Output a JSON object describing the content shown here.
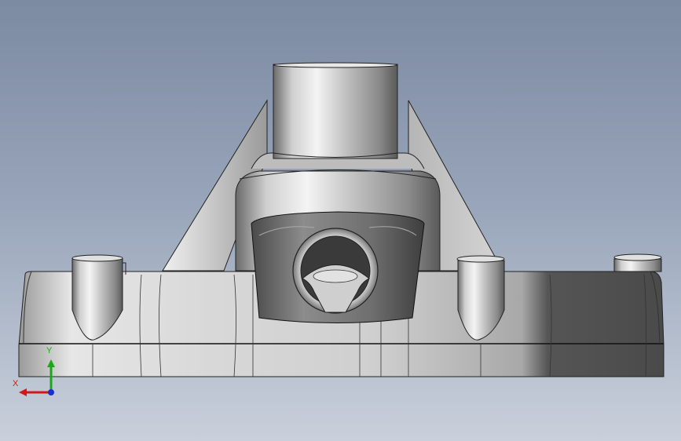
{
  "viewport": {
    "background_top": "#7c8aa2",
    "background_bottom": "#c9d0db"
  },
  "triad": {
    "x_label": "X",
    "y_label": "Y",
    "x_color": "#d01818",
    "y_color": "#18a818",
    "z_color": "#1830d0"
  },
  "model": {
    "icon": "cast-housing-3d-model"
  }
}
